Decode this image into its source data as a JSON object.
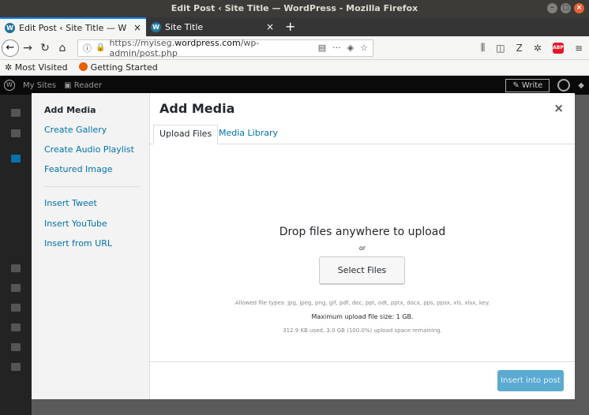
{
  "window": {
    "title": "Edit Post ‹ Site Title — WordPress - Mozilla Firefox"
  },
  "browser": {
    "tabs": [
      {
        "label": "Edit Post ‹ Site Title — W"
      },
      {
        "label": "Site Title"
      }
    ],
    "url_prefix": "https://myiseg.",
    "url_domain": "wordpress.com",
    "url_path": "/wp-admin/post.php",
    "bookmarks": [
      {
        "label": "Most Visited"
      },
      {
        "label": "Getting Started"
      }
    ]
  },
  "wpbar": {
    "my_sites": "My Sites",
    "reader": "Reader",
    "write": "Write"
  },
  "modal": {
    "title": "Add Media",
    "menu": [
      {
        "label": "Add Media",
        "active": true
      },
      {
        "label": "Create Gallery"
      },
      {
        "label": "Create Audio Playlist"
      },
      {
        "label": "Featured Image"
      },
      {
        "label": "Insert Tweet"
      },
      {
        "label": "Insert YouTube"
      },
      {
        "label": "Insert from URL"
      }
    ],
    "tabs": [
      {
        "label": "Upload Files",
        "active": true
      },
      {
        "label": "Media Library"
      }
    ],
    "drop_text": "Drop files anywhere to upload",
    "or_text": "or",
    "select_button": "Select Files",
    "allowed_types": "Allowed file types: jpg, jpeg, png, gif, pdf, doc, ppt, odt, pptx, docx, pps, ppsx, xls, xlsx, key.",
    "max_size": "Maximum upload file size: 1 GB.",
    "space": "312.9 KB used, 3.0 GB (100.0%) upload space remaining.",
    "insert_button": "Insert into post"
  }
}
